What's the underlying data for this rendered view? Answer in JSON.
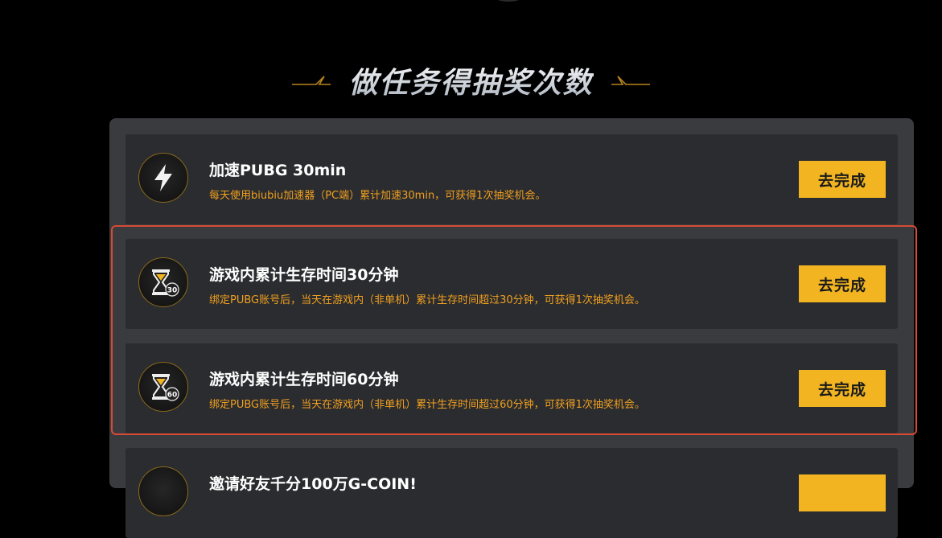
{
  "section": {
    "title": "做任务得抽奖次数"
  },
  "tasks": [
    {
      "icon": "lightning-icon",
      "title": "加速PUBG 30min",
      "description": "每天使用biubiu加速器（PC端）累计加速30min，可获得1次抽奖机会。",
      "button_label": "去完成"
    },
    {
      "icon": "hourglass-30-icon",
      "badge": "30",
      "title": "游戏内累计生存时间30分钟",
      "description": "绑定PUBG账号后，当天在游戏内（非单机）累计生存时间超过30分钟，可获得1次抽奖机会。",
      "button_label": "去完成"
    },
    {
      "icon": "hourglass-60-icon",
      "badge": "60",
      "title": "游戏内累计生存时间60分钟",
      "description": "绑定PUBG账号后，当天在游戏内（非单机）累计生存时间超过60分钟，可获得1次抽奖机会。",
      "button_label": "去完成"
    },
    {
      "title": "邀请好友千分100万G-COIN!"
    }
  ],
  "colors": {
    "accent": "#f2b521",
    "description_text": "#f0a020",
    "highlight_border": "#d94a35",
    "card_bg": "#2b2c2f",
    "panel_bg": "#3a3b3e"
  }
}
